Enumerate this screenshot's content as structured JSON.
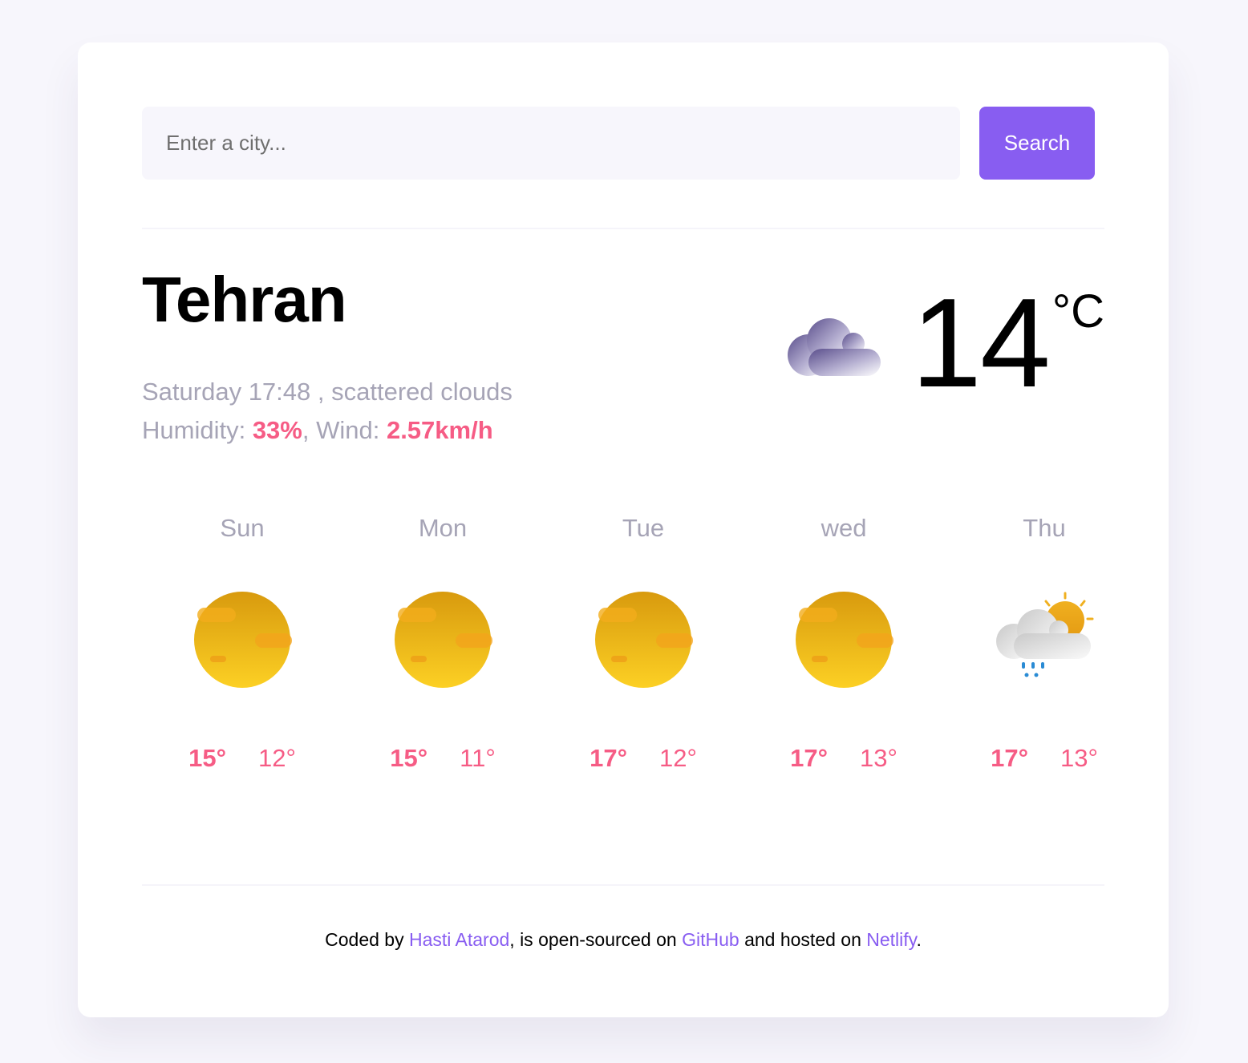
{
  "search": {
    "placeholder": "Enter a city...",
    "value": "",
    "button_label": "Search"
  },
  "current": {
    "city": "Tehran",
    "day_time": "Saturday 17:48",
    "separator": " , ",
    "description": "scattered clouds",
    "humidity_label": "Humidity: ",
    "humidity_value": "33%",
    "wind_label": ", Wind: ",
    "wind_value": "2.57km/h",
    "temperature": "14",
    "unit": "°C",
    "icon": "scattered-clouds-icon"
  },
  "forecast": [
    {
      "day": "Sun",
      "max": "15°",
      "min": "12°",
      "icon": "sun-icon"
    },
    {
      "day": "Mon",
      "max": "15°",
      "min": "11°",
      "icon": "sun-icon"
    },
    {
      "day": "Tue",
      "max": "17°",
      "min": "12°",
      "icon": "sun-icon"
    },
    {
      "day": "wed",
      "max": "17°",
      "min": "13°",
      "icon": "sun-icon"
    },
    {
      "day": "Thu",
      "max": "17°",
      "min": "13°",
      "icon": "sun-cloud-rain-icon"
    }
  ],
  "footer": {
    "prefix": "Coded by ",
    "author_link": "Hasti Atarod",
    "middle": ", is open-sourced on ",
    "github_link": "GitHub",
    "hosted": " and hosted on ",
    "netlify_link": "Netlify",
    "suffix": "."
  },
  "colors": {
    "accent": "#885df1",
    "highlight": "#f65c85",
    "muted_text": "#a6a4b6",
    "page_bg": "#f7f6fc"
  }
}
